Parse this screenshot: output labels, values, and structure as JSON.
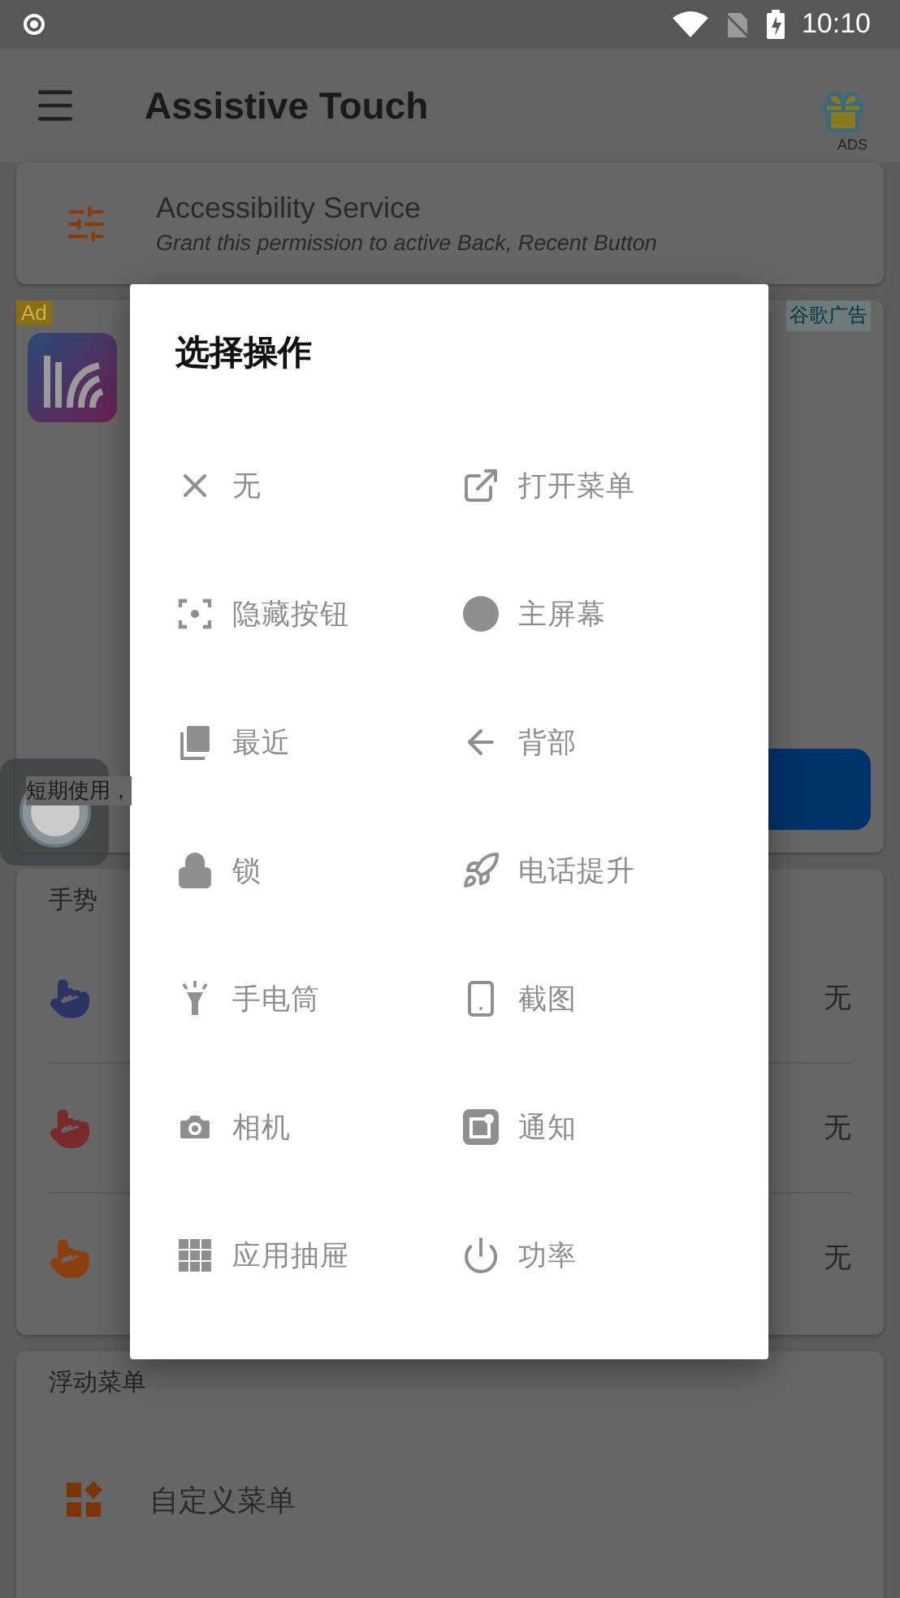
{
  "status_bar": {
    "time": "10:10"
  },
  "app_bar": {
    "title": "Assistive Touch",
    "ads_label": "ADS"
  },
  "accessibility_card": {
    "title": "Accessibility Service",
    "subtitle": "Grant this permission to active Back, Recent Button"
  },
  "ad": {
    "badge": "Ad",
    "source": "谷歌广告",
    "text": "短期使用，"
  },
  "gestures": {
    "title": "手势",
    "rows": [
      {
        "value": "无",
        "color": "#2a3566"
      },
      {
        "value": "无",
        "color": "#7a2a2a"
      },
      {
        "value": "无",
        "color": "#8a3f0e"
      }
    ]
  },
  "floating_menu": {
    "title": "浮动菜单",
    "items": [
      {
        "label": "自定义菜单"
      }
    ]
  },
  "dialog": {
    "title": "选择操作",
    "options": [
      {
        "label": "无",
        "kind": "none"
      },
      {
        "label": "打开菜单",
        "kind": "open"
      },
      {
        "label": "隐藏按钮",
        "kind": "hide"
      },
      {
        "label": "主屏幕",
        "kind": "home"
      },
      {
        "label": "最近",
        "kind": "recent"
      },
      {
        "label": "背部",
        "kind": "back"
      },
      {
        "label": "锁",
        "kind": "lock"
      },
      {
        "label": "电话提升",
        "kind": "boost"
      },
      {
        "label": "手电筒",
        "kind": "flashlight"
      },
      {
        "label": "截图",
        "kind": "screenshot"
      },
      {
        "label": "相机",
        "kind": "camera"
      },
      {
        "label": "通知",
        "kind": "notification"
      },
      {
        "label": "应用抽屉",
        "kind": "drawer"
      },
      {
        "label": "功率",
        "kind": "power"
      }
    ]
  }
}
